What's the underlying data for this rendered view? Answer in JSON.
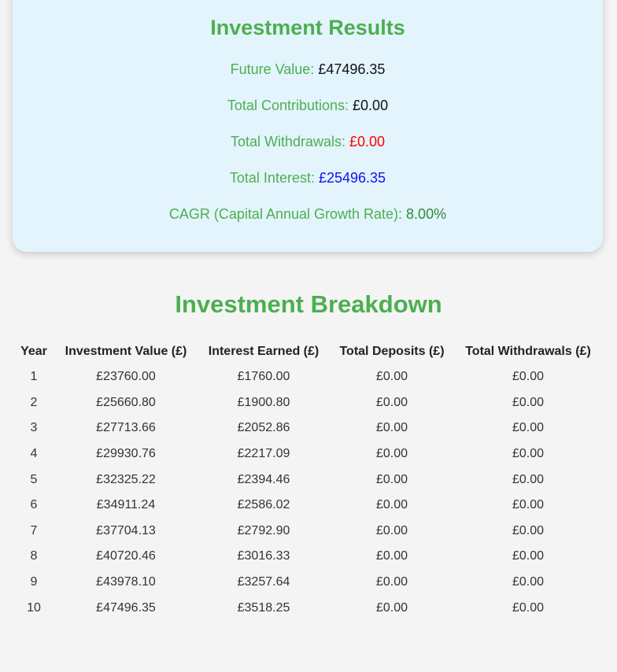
{
  "results": {
    "title": "Investment Results",
    "future_value_label": "Future Value:",
    "future_value": "£47496.35",
    "total_contributions_label": "Total Contributions:",
    "total_contributions": "£0.00",
    "total_withdrawals_label": "Total Withdrawals:",
    "total_withdrawals": "£0.00",
    "total_interest_label": "Total Interest:",
    "total_interest": "£25496.35",
    "cagr_label": "CAGR (Capital Annual Growth Rate):",
    "cagr": "8.00%",
    "colors": {
      "accent": "#4caf50",
      "withdrawals": "#ff0000",
      "interest": "#1212ee",
      "cagr": "#2e8b3a",
      "card_background": "#e3f4fc"
    }
  },
  "breakdown": {
    "title": "Investment Breakdown",
    "headers": [
      "Year",
      "Investment Value (£)",
      "Interest Earned (£)",
      "Total Deposits (£)",
      "Total Withdrawals (£)"
    ],
    "rows": [
      [
        "1",
        "£23760.00",
        "£1760.00",
        "£0.00",
        "£0.00"
      ],
      [
        "2",
        "£25660.80",
        "£1900.80",
        "£0.00",
        "£0.00"
      ],
      [
        "3",
        "£27713.66",
        "£2052.86",
        "£0.00",
        "£0.00"
      ],
      [
        "4",
        "£29930.76",
        "£2217.09",
        "£0.00",
        "£0.00"
      ],
      [
        "5",
        "£32325.22",
        "£2394.46",
        "£0.00",
        "£0.00"
      ],
      [
        "6",
        "£34911.24",
        "£2586.02",
        "£0.00",
        "£0.00"
      ],
      [
        "7",
        "£37704.13",
        "£2792.90",
        "£0.00",
        "£0.00"
      ],
      [
        "8",
        "£40720.46",
        "£3016.33",
        "£0.00",
        "£0.00"
      ],
      [
        "9",
        "£43978.10",
        "£3257.64",
        "£0.00",
        "£0.00"
      ],
      [
        "10",
        "£47496.35",
        "£3518.25",
        "£0.00",
        "£0.00"
      ]
    ]
  }
}
